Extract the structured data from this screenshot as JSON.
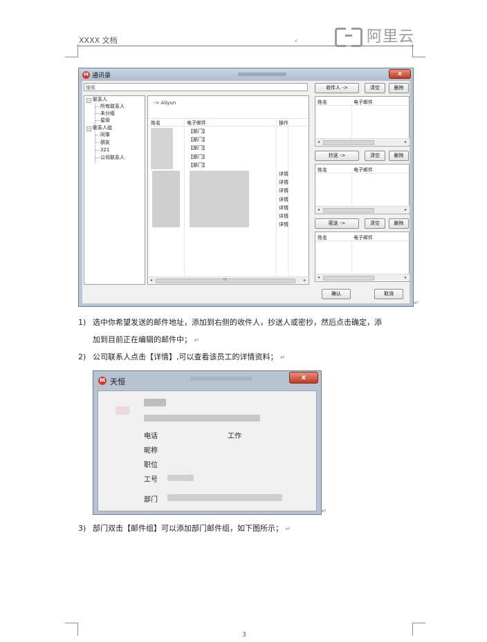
{
  "header": {
    "doc_title": "XXXX 文档",
    "mark": "↲",
    "logo_text": "阿里云"
  },
  "address_book": {
    "title": "通讯录",
    "close": "x",
    "search_placeholder": "搜索",
    "tree": {
      "contacts": "联系人",
      "all": "所有联系人",
      "ungrouped": "未分组",
      "starred": "星级",
      "groups": "联系人组",
      "colleagues": "同事",
      "friends": "朋友",
      "group_321": "321",
      "company_contacts": "公司联系人",
      "expand_glyph": "−"
    },
    "breadcrumb": "-> Aliyun",
    "columns": {
      "name": "姓名",
      "email": "电子邮件",
      "action": "操作"
    },
    "dept_rows": [
      "【部门】",
      "【部门】",
      "【部门】",
      "【部门】",
      "【部门】"
    ],
    "detail_label": "详情",
    "detail_count": 7,
    "scroll_thumb": "III",
    "arrow_left": "◂",
    "arrow_right": "▸",
    "to_button": "收件人 ->",
    "cc_button": "抄送 ->",
    "bcc_button": "密送 ->",
    "clear_button": "清空",
    "delete_button": "删除",
    "recip_columns": {
      "name": "姓名",
      "email": "电子邮件"
    },
    "ok_button": "确认",
    "cancel_button": "取消"
  },
  "steps": {
    "s1_num": "1)",
    "s1_line1": "选中你希望发送的邮件地址，添加到右侧的收件人，抄送人或密抄，然后点击确定，添",
    "s1_line2": "加到目前正在编辑的邮件中；",
    "s2_num": "2)",
    "s2_text": "公司联系人点击【详情】,可以查看该员工的详情资料；",
    "s3_num": "3)",
    "s3_text": "部门双击【邮件组】可以添加部门邮件组，如下图所示；",
    "return_mark": "↵"
  },
  "details_window": {
    "title": "天恒",
    "close": "x",
    "phone": "电话",
    "work": "工作",
    "nickname": "昵称",
    "position": "职位",
    "employee_id": "工号",
    "department": "部门"
  },
  "footer": {
    "page_number": "3"
  }
}
